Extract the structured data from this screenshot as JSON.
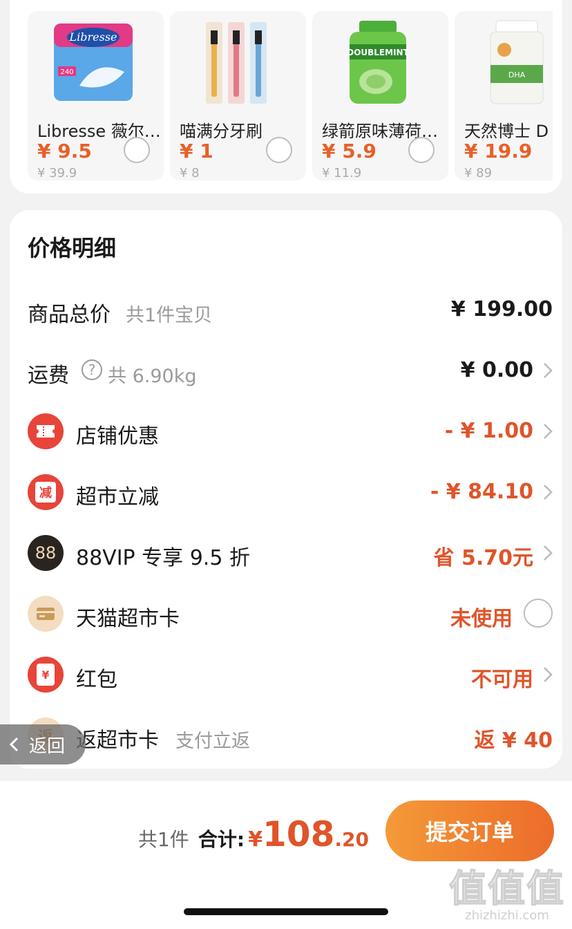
{
  "products": [
    {
      "name": "Libresse 薇尔…",
      "price": "¥ 9.5",
      "original_price": "¥ 39.9",
      "image": "libresse-pad-pack"
    },
    {
      "name": "喵满分牙刷",
      "price": "¥ 1",
      "original_price": "¥ 8",
      "image": "toothbrush-pack"
    },
    {
      "name": "绿箭原味薄荷…",
      "price": "¥ 5.9",
      "original_price": "¥ 11.9",
      "image": "doublemint-bottle"
    },
    {
      "name": "天然博士 D",
      "price": "¥ 19.9",
      "original_price": "¥ 89",
      "image": "natures-way-dha-bottle"
    }
  ],
  "price_detail": {
    "title": "价格明细",
    "goods_total": {
      "label": "商品总价",
      "sub": "共1件宝贝",
      "value": "¥ 199.00"
    },
    "shipping": {
      "label": "运费",
      "sub": "共 6.90kg",
      "value": "¥ 0.00",
      "icon": "question-circle-icon"
    },
    "store_discount": {
      "label": "店铺优惠",
      "value": "- ¥ 1.00",
      "icon": "coupon-icon",
      "icon_color": "#e8443a"
    },
    "market_reduce": {
      "label": "超市立减",
      "value": "- ¥ 84.10",
      "icon_text": "减",
      "icon_color": "#e8443a"
    },
    "vip": {
      "label": "88VIP 专享 9.5 折",
      "value": "省 5.70元",
      "icon_text": "88",
      "icon_color": "#2a2420"
    },
    "tmall_card": {
      "label": "天猫超市卡",
      "value": "未使用",
      "icon": "card-icon",
      "icon_color": "#f3dcc0"
    },
    "red_packet": {
      "label": "红包",
      "value": "不可用",
      "icon_text": "¥",
      "icon_color": "#e8443a"
    },
    "cashback_card": {
      "label": "返超市卡",
      "sub": "支付立返",
      "value": "返 ¥ 40",
      "icon_text": "返",
      "icon_color": "#f3dcc0"
    }
  },
  "back_button": {
    "label": "返回"
  },
  "bottom_bar": {
    "count_text": "共1件",
    "total_label": "合计:",
    "currency": "¥",
    "total_int": "108",
    "total_dec": ".20",
    "submit_label": "提交订单"
  },
  "watermark": {
    "logo": "值值值",
    "site": "zhizhizhi.com"
  },
  "colors": {
    "accent": "#e0542a",
    "button_start": "#f49a38",
    "button_end": "#ec6c2a",
    "background": "#f2f2f2"
  }
}
